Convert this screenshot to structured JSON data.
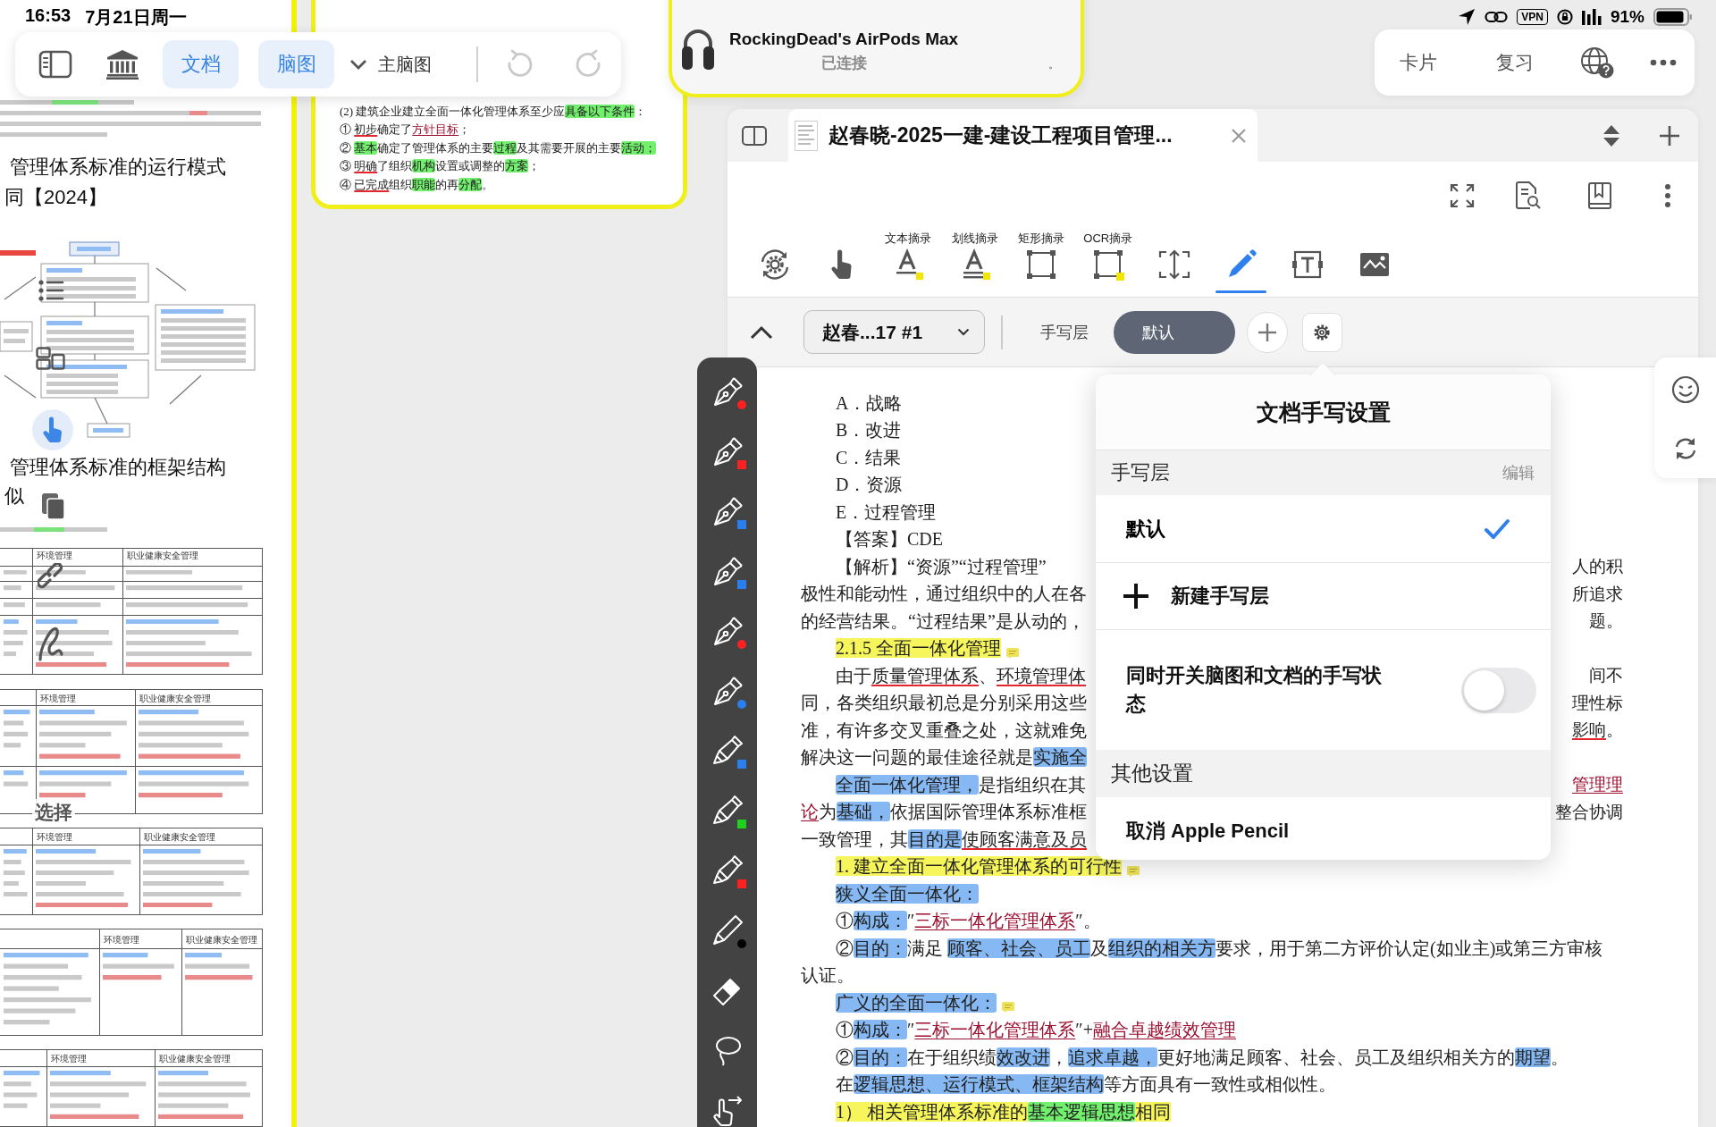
{
  "status_bar": {
    "time": "16:53",
    "date": "7月21日周一",
    "vpn": "VPN",
    "battery": "91%"
  },
  "floating_toolbar": {
    "views": [
      {
        "label": "文档",
        "on": true
      },
      {
        "label": "脑图",
        "on": true
      }
    ],
    "outline": "主脑图",
    "undo_disabled": true,
    "redo_disabled": true
  },
  "notification": {
    "title": "RockingDead's AirPods Max",
    "status": "已连接",
    "trailing_mark": "。"
  },
  "top_actions": {
    "buttons": [
      "卡片",
      "复习"
    ]
  },
  "left_document": {
    "headings": [
      {
        "lines": [
          "管理体系标准的运行模式",
          "同【2024】"
        ]
      },
      {
        "lines": [
          "管理体系标准的框架结构",
          "似"
        ]
      }
    ],
    "tables": [
      {
        "headers": [
          "环境管理",
          "职业健康安全管理"
        ]
      },
      {
        "headers": [
          "环境管理",
          "职业健康安全管理"
        ]
      },
      {
        "headers": [
          "环境管理",
          "职业健康安全管理"
        ]
      },
      {
        "headers": [
          "环境管理",
          "职业健康安全管理"
        ]
      },
      {
        "headers": [
          "环境管理",
          "职业健康安全管理"
        ]
      }
    ],
    "palette_label": "选择"
  },
  "preview_card": {
    "lines": [
      [
        {
          "kind": "plain",
          "text": "(2) 建筑企业建立全面一体化管理体系至少应"
        },
        {
          "kind": "hl_green",
          "text": "具备以下条件"
        },
        {
          "kind": "plain",
          "text": "："
        }
      ],
      [
        {
          "kind": "plain",
          "text": "① "
        },
        {
          "kind": "underline",
          "text": "初步"
        },
        {
          "kind": "plain",
          "text": "确定了"
        },
        {
          "kind": "link",
          "text": "方针目标"
        },
        {
          "kind": "plain",
          "text": "；"
        }
      ],
      [
        {
          "kind": "plain",
          "text": "② "
        },
        {
          "kind": "hl_green",
          "text": "基本"
        },
        {
          "kind": "plain",
          "text": "确定了管理体系的主要"
        },
        {
          "kind": "hl_green",
          "text": "过程"
        },
        {
          "kind": "plain",
          "text": "及其需要开展的主要"
        },
        {
          "kind": "hl_green",
          "text": "活动；"
        }
      ],
      [
        {
          "kind": "plain",
          "text": "③ "
        },
        {
          "kind": "underline",
          "text": "明确"
        },
        {
          "kind": "plain",
          "text": "了组织"
        },
        {
          "kind": "hl_green",
          "text": "机构"
        },
        {
          "kind": "plain",
          "text": "设置或调整的"
        },
        {
          "kind": "hl_green",
          "text": "方案"
        },
        {
          "kind": "plain",
          "text": "；"
        }
      ],
      [
        {
          "kind": "plain",
          "text": "④ "
        },
        {
          "kind": "underline",
          "text": "已完成"
        },
        {
          "kind": "plain",
          "text": "组织"
        },
        {
          "kind": "hl_green",
          "text": "职能"
        },
        {
          "kind": "plain",
          "text": "的再"
        },
        {
          "kind": "hl_green",
          "text": "分配"
        },
        {
          "kind": "plain",
          "text": "。"
        }
      ]
    ]
  },
  "doc_window": {
    "tab": {
      "title": "赵春晓-2025一建-建设工程项目管理...",
      "selected": true
    },
    "tools": [
      {
        "kind": "rotate",
        "selected": false
      },
      {
        "kind": "hand",
        "selected": false
      },
      {
        "kind": "text_excerpt",
        "label": "文本摘录",
        "selected": false
      },
      {
        "kind": "underline_excerpt",
        "label": "划线摘录",
        "selected": false
      },
      {
        "kind": "rect_excerpt",
        "label": "矩形摘录",
        "selected": false
      },
      {
        "kind": "ocr_excerpt",
        "label": "OCR摘录",
        "selected": false
      },
      {
        "kind": "crop",
        "selected": false
      },
      {
        "kind": "pencil",
        "selected": true
      },
      {
        "kind": "text_box",
        "selected": false
      },
      {
        "kind": "image",
        "selected": false
      }
    ],
    "layer_bar": {
      "document": "赵春...17 #1",
      "layer_label": "手写层",
      "layer": "默认"
    },
    "lines": [
      {
        "indent": true,
        "note": false,
        "segments": [
          {
            "kind": "plain",
            "text": "A．战略"
          }
        ]
      },
      {
        "indent": true,
        "note": false,
        "segments": [
          {
            "kind": "plain",
            "text": "B．改进"
          }
        ]
      },
      {
        "indent": true,
        "note": false,
        "segments": [
          {
            "kind": "plain",
            "text": "C．结果"
          }
        ]
      },
      {
        "indent": true,
        "note": false,
        "segments": [
          {
            "kind": "plain",
            "text": "D．资源"
          }
        ]
      },
      {
        "indent": true,
        "note": false,
        "segments": [
          {
            "kind": "plain",
            "text": "E．过程管理"
          }
        ]
      },
      {
        "indent": true,
        "note": false,
        "segments": [
          {
            "kind": "plain",
            "text": "【答案】CDE"
          }
        ]
      },
      {
        "indent": true,
        "note": false,
        "segments": [
          {
            "kind": "plain",
            "text": "【解析】“资源”“过程管理”"
          }
        ],
        "right": [
          {
            "kind": "plain",
            "text": "人的积"
          }
        ]
      },
      {
        "indent": false,
        "note": false,
        "segments": [
          {
            "kind": "plain",
            "text": "极性和能动性，通过组织中的人在各"
          }
        ],
        "right": [
          {
            "kind": "plain",
            "text": "所追求"
          }
        ]
      },
      {
        "indent": false,
        "note": false,
        "segments": [
          {
            "kind": "plain",
            "text": "的经营结果。“过程结果”是从动的，"
          }
        ],
        "right": [
          {
            "kind": "plain",
            "text": "题。"
          }
        ]
      },
      {
        "indent": true,
        "note": true,
        "segments": [
          {
            "kind": "hl_yellow",
            "text": "2.1.5 全面一体化管理"
          }
        ]
      },
      {
        "indent": true,
        "note": false,
        "segments": [
          {
            "kind": "plain",
            "text": "由于"
          },
          {
            "kind": "underline",
            "text": "质量管理体系"
          },
          {
            "kind": "plain",
            "text": "、"
          },
          {
            "kind": "underline",
            "text": "环境管理体"
          }
        ],
        "right": [
          {
            "kind": "plain",
            "text": "间不"
          }
        ]
      },
      {
        "indent": false,
        "note": false,
        "segments": [
          {
            "kind": "plain",
            "text": "同，各类组织最初总是分别采用这些"
          }
        ],
        "right": [
          {
            "kind": "plain",
            "text": "理性标"
          }
        ]
      },
      {
        "indent": false,
        "note": false,
        "segments": [
          {
            "kind": "plain",
            "text": "准，有许多交叉重叠之处，这就难免"
          }
        ],
        "right": [
          {
            "kind": "underline",
            "text": "影响"
          },
          {
            "kind": "plain",
            "text": "。"
          }
        ]
      },
      {
        "indent": false,
        "note": false,
        "segments": [
          {
            "kind": "plain",
            "text": "解决这一问题的最佳途径就是"
          },
          {
            "kind": "hl_blue",
            "text": "实施全"
          }
        ]
      },
      {
        "indent": true,
        "note": false,
        "segments": [
          {
            "kind": "hl_blue",
            "text": "全面一体化管理，"
          },
          {
            "kind": "plain",
            "text": "是指组织在其"
          }
        ],
        "right": [
          {
            "kind": "link",
            "text": "管理理"
          }
        ]
      },
      {
        "indent": false,
        "note": false,
        "segments": [
          {
            "kind": "link",
            "text": "论"
          },
          {
            "kind": "plain",
            "text": "为"
          },
          {
            "kind": "hl_blue",
            "text": "基础，"
          },
          {
            "kind": "plain",
            "text": "依据国际管理体系标准框"
          }
        ],
        "right": [
          {
            "kind": "plain",
            "text": "整合协调"
          }
        ]
      },
      {
        "indent": false,
        "note": false,
        "segments": [
          {
            "kind": "plain",
            "text": "一致管理，其"
          },
          {
            "kind": "hl_blue",
            "text": "目的是"
          },
          {
            "kind": "underline",
            "text": "使顾客满意及员"
          }
        ]
      },
      {
        "indent": true,
        "note": true,
        "segments": [
          {
            "kind": "hl_yellow",
            "text": "1. 建立全面一体化管理体系的可行性"
          }
        ]
      },
      {
        "indent": true,
        "note": false,
        "segments": [
          {
            "kind": "hl_blue",
            "text": "狭义全面一体化："
          }
        ]
      },
      {
        "indent": true,
        "note": false,
        "segments": [
          {
            "kind": "plain",
            "text": "①"
          },
          {
            "kind": "hl_blue",
            "text": "构成："
          },
          {
            "kind": "plain",
            "text": "″"
          },
          {
            "kind": "link",
            "text": "三标一体化管理体系"
          },
          {
            "kind": "plain",
            "text": "″。"
          }
        ]
      },
      {
        "indent": true,
        "note": false,
        "segments": [
          {
            "kind": "plain",
            "text": "②"
          },
          {
            "kind": "hl_blue",
            "text": "目的："
          },
          {
            "kind": "plain",
            "text": "满足 "
          },
          {
            "kind": "hl_blue",
            "text": "顾客、社会、员工"
          },
          {
            "kind": "plain",
            "text": "及"
          },
          {
            "kind": "hl_blue",
            "text": "组织的相关方"
          },
          {
            "kind": "plain",
            "text": "要求，用于第二方评价认定(如业主)或第三方审核"
          }
        ]
      },
      {
        "indent": false,
        "note": false,
        "segments": [
          {
            "kind": "plain",
            "text": "认证。"
          }
        ]
      },
      {
        "indent": true,
        "note": true,
        "segments": [
          {
            "kind": "hl_blue",
            "text": "广义的全面一体化："
          }
        ]
      },
      {
        "indent": true,
        "note": false,
        "segments": [
          {
            "kind": "plain",
            "text": "①"
          },
          {
            "kind": "hl_blue",
            "text": "构成："
          },
          {
            "kind": "plain",
            "text": "″"
          },
          {
            "kind": "link",
            "text": "三标一体化管理体系"
          },
          {
            "kind": "plain",
            "text": "″+"
          },
          {
            "kind": "link",
            "text": "融合卓越绩效管理"
          }
        ]
      },
      {
        "indent": true,
        "note": false,
        "segments": [
          {
            "kind": "plain",
            "text": "②"
          },
          {
            "kind": "hl_blue",
            "text": "目的："
          },
          {
            "kind": "plain",
            "text": "在于组织绩"
          },
          {
            "kind": "hl_blue",
            "text": "效改进"
          },
          {
            "kind": "plain",
            "text": "，"
          },
          {
            "kind": "hl_blue",
            "text": "追求卓越，"
          },
          {
            "kind": "plain",
            "text": "更好地满足顾客、社会、员工及组织相关方的"
          },
          {
            "kind": "hl_blue",
            "text": "期望"
          },
          {
            "kind": "plain",
            "text": "。"
          }
        ]
      },
      {
        "indent": true,
        "note": false,
        "segments": [
          {
            "kind": "plain",
            "text": "在"
          },
          {
            "kind": "hl_blue",
            "text": "逻辑思想、运行模式、框架结构"
          },
          {
            "kind": "plain",
            "text": "等方面具有一致性或相似性。"
          }
        ]
      },
      {
        "indent": true,
        "note": false,
        "segments": [
          {
            "kind": "hl_yellow",
            "text": "1） 相关管理体系标准的"
          },
          {
            "kind": "hl_green",
            "text": "基本逻辑思想"
          },
          {
            "kind": "hl_yellow",
            "text": "相同"
          }
        ]
      }
    ]
  },
  "pen_toolbar": {
    "tools": [
      {
        "kind": "pen",
        "color": "#ff2121",
        "round": true
      },
      {
        "kind": "pen",
        "color": "#ff2121",
        "round": false
      },
      {
        "kind": "pen",
        "color": "#2a7ff0",
        "round": false
      },
      {
        "kind": "pen",
        "color": "#2a7ff0",
        "round": false
      },
      {
        "kind": "pen",
        "color": "#ff2121",
        "round": true
      },
      {
        "kind": "pen",
        "color": "#2a7ff0",
        "round": true
      },
      {
        "kind": "highlighter",
        "color": "#2a7ff0",
        "round": false
      },
      {
        "kind": "highlighter",
        "color": "#1fd21f",
        "round": false
      },
      {
        "kind": "highlighter",
        "color": "#ff2121",
        "round": false
      },
      {
        "kind": "pencil",
        "color": "#000000",
        "round": true
      },
      {
        "kind": "eraser"
      },
      {
        "kind": "lasso"
      },
      {
        "kind": "hand"
      }
    ]
  },
  "handwriting_popover": {
    "title": "文档手写设置",
    "sections": [
      {
        "header": "手写层",
        "action": "编辑",
        "rows": [
          {
            "kind": "choice",
            "label": "默认",
            "selected": true
          },
          {
            "kind": "add",
            "label": "新建手写层"
          },
          {
            "kind": "toggle",
            "label": "同时开关脑图和文档的手写状态",
            "on": false
          }
        ]
      },
      {
        "header": "其他设置",
        "rows": [
          {
            "kind": "action",
            "label": "取消 Apple Pencil"
          }
        ]
      }
    ]
  }
}
